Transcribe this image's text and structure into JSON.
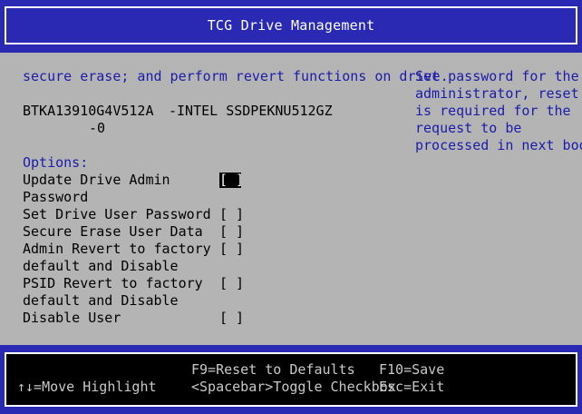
{
  "header": {
    "title": "TCG Drive Management"
  },
  "main": {
    "description": "secure erase; and perform revert functions on drive.",
    "drive": {
      "serial": "BTKA13910G4V512A",
      "model": "-INTEL SSDPEKNU512GZ",
      "index": "-0"
    },
    "options_heading": "Options:",
    "options": [
      {
        "label_line1": "Update Drive Admin",
        "label_line2": "Password",
        "value": "[ ]"
      },
      {
        "label_line1": "Set Drive User Password",
        "label_line2": "",
        "value": "[ ]"
      },
      {
        "label_line1": "Secure Erase User Data",
        "label_line2": "",
        "value": "[ ]"
      },
      {
        "label_line1": "Admin Revert to factory",
        "label_line2": "default and Disable",
        "value": "[ ]"
      },
      {
        "label_line1": "PSID Revert to factory",
        "label_line2": "default and Disable",
        "value": "[ ]"
      },
      {
        "label_line1": "Disable User",
        "label_line2": "",
        "value": "[ ]"
      }
    ]
  },
  "help": {
    "lines": [
      "Set password for the",
      "administrator, reset",
      "is required for the",
      "request to be",
      "processed in next boot"
    ]
  },
  "footer": {
    "move": "↑↓=Move Highlight",
    "f9": "F9=Reset to Defaults",
    "f10": "F10=Save",
    "space": "<Spacebar>Toggle Checkbox",
    "esc": "Esc=Exit"
  },
  "colors": {
    "frame_blue": "#2929b4",
    "panel_gray": "#b4b4b4",
    "text_blue": "#1c1caa",
    "footer_text": "#c8c8c8"
  }
}
